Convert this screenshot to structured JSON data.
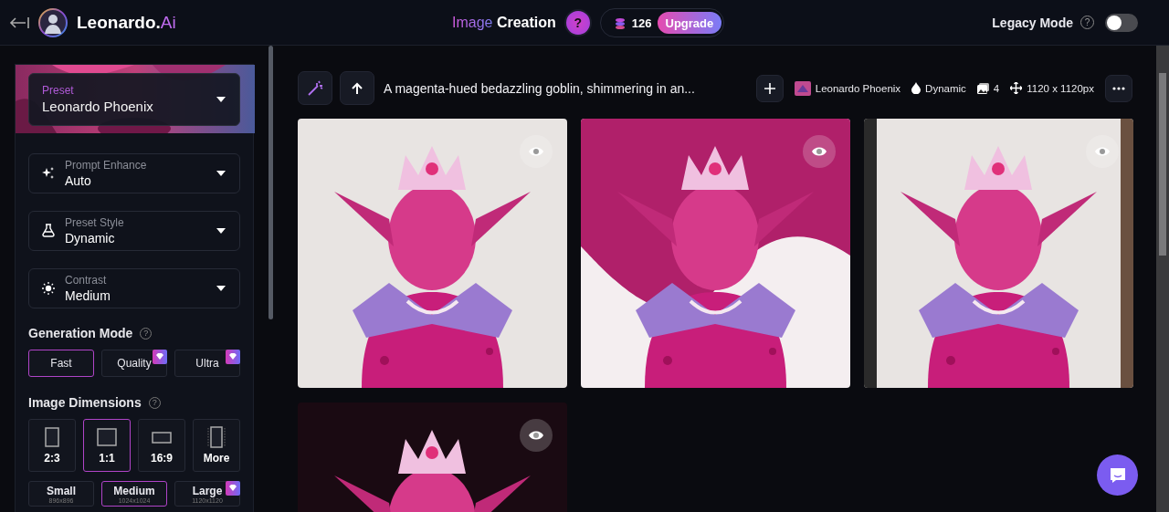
{
  "header": {
    "logo": {
      "name": "Leonardo.",
      "accent": "Ai"
    },
    "title": {
      "accent": "Image",
      "rest": "Creation"
    },
    "help": "?",
    "credits": "126",
    "upgrade": "Upgrade",
    "legacy": {
      "label": "Legacy Mode",
      "help": "?",
      "on": false
    }
  },
  "sidebar": {
    "preset": {
      "label": "Preset",
      "value": "Leonardo Phoenix"
    },
    "dropdowns": [
      {
        "kind": "sparkle",
        "label": "Prompt Enhance",
        "value": "Auto"
      },
      {
        "kind": "flask",
        "label": "Preset Style",
        "value": "Dynamic"
      },
      {
        "kind": "sun",
        "label": "Contrast",
        "value": "Medium"
      }
    ],
    "generation_mode": {
      "title": "Generation Mode",
      "help": "?",
      "options": [
        {
          "label": "Fast",
          "selected": true,
          "premium": false
        },
        {
          "label": "Quality",
          "selected": false,
          "premium": true
        },
        {
          "label": "Ultra",
          "selected": false,
          "premium": true
        }
      ]
    },
    "image_dimensions": {
      "title": "Image Dimensions",
      "help": "?",
      "ratios": [
        {
          "kind": "portrait",
          "label": "2:3",
          "selected": false
        },
        {
          "kind": "square",
          "label": "1:1",
          "selected": true
        },
        {
          "kind": "landscape",
          "label": "16:9",
          "selected": false
        },
        {
          "kind": "more",
          "label": "More",
          "selected": false
        }
      ],
      "sizes": [
        {
          "label": "Small",
          "detail": "896x896",
          "selected": false,
          "premium": false
        },
        {
          "label": "Medium",
          "detail": "1024x1024",
          "selected": true,
          "premium": false
        },
        {
          "label": "Large",
          "detail": "1120x1120",
          "selected": false,
          "premium": true
        }
      ]
    }
  },
  "toolbar": {
    "prompt": "A magenta-hued bedazzling goblin, shimmering in an...",
    "model": "Leonardo Phoenix",
    "style": "Dynamic",
    "count": "4",
    "dimensions": "1120 x 1120px"
  }
}
